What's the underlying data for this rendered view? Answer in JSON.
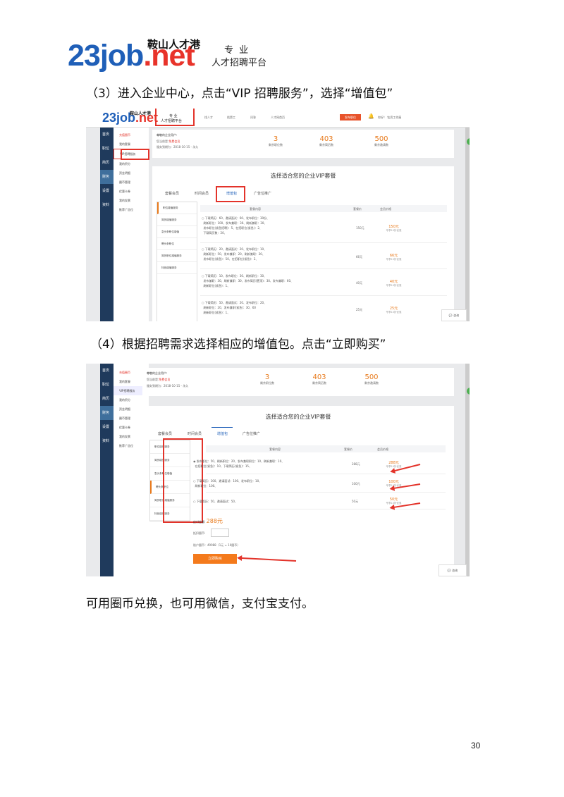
{
  "logo": {
    "main": "23job",
    "net": ".net",
    "cn_name": "鞍山人才港",
    "tag1": "专 业",
    "tag2": "人才招聘平台"
  },
  "steps": {
    "s3": "（3）进入企业中心，点击“VIP 招聘服务”，选择“增值包”",
    "s4": "（4）根据招聘需求选择相应的增值包。点击“立即购买”",
    "note": "可用圈币兑换，也可用微信，支付宝支付。"
  },
  "shot1": {
    "logo_cn": "鞍山人才港",
    "logo_tag1": "专 业",
    "logo_tag2": "人才招聘平台",
    "topnav": [
      "找人才",
      "找第工",
      "问答",
      "人才网首页"
    ],
    "publish": "发布职位",
    "user": "你好！ 钛资工作屋",
    "side": [
      "首页",
      "职位",
      "简历",
      "财务",
      "设置",
      "资料"
    ],
    "menu": [
      "充值圈币",
      "我的套餐",
      "VIP招聘服务",
      "我的积分",
      "资金明细",
      "圈币管理",
      "优惠卡券",
      "我的发票",
      "推荐广告位"
    ],
    "greet": "尊敬的企业用户:",
    "level_label": "您当前是:",
    "level": "免费会员",
    "expire": "服务到期为：2018-10-15 - 永久",
    "stats": [
      {
        "num": "3",
        "label": "剩余职位数"
      },
      {
        "num": "403",
        "label": "剩余简历数"
      },
      {
        "num": "500",
        "label": "剩余邀请数"
      }
    ],
    "panel_title": "选择适合您的企业VIP套餐",
    "tabs": [
      "套餐会员",
      "时间会员",
      "增值包",
      "广告位推广"
    ],
    "pkg_list": [
      "职位增值服务",
      "简历增值服务",
      "急头条职位增值",
      "聘头条职位",
      "简历职位增值服务",
      "特色增值服务"
    ],
    "headers": {
      "content": "套餐内容",
      "qty": "套餐价",
      "price": "会员价格"
    },
    "rows": [
      {
        "l1": "下载简历：60、邀请面试：60、发布职位：30份、",
        "l2": "刷新职位：100、发布兼职：30、刷新兼职：30、",
        "l3": "发布职位(紧急招聘)：5、在招职位(紧急)：2、",
        "l4": "下载简历数：20、",
        "qty": "150元",
        "price": "150元",
        "sub": "专享10折优惠"
      },
      {
        "l1": "下载简历：20、邀请面试：20、发布职位：10、",
        "l2": "刷新职位：50、发布兼职：20、刷新兼职：20、",
        "l3": "发布职位(紧急)：50、在招职位(紧急)：2、",
        "l4": "",
        "qty": "66元",
        "price": "66元",
        "sub": "专享10折优惠"
      },
      {
        "l1": "下载简历：10、发布职位：30、刷新职位：30、",
        "l2": "发布兼职：30、刷新兼职：30、发布简历(置顶)：30、发布兼职：60、",
        "l3": "刷新职位(紧急)：1、",
        "l4": "",
        "qty": "40元",
        "price": "40元",
        "sub": "专享10折优惠"
      },
      {
        "l1": "下载简历：50、邀请面试：20、发布职位：20、",
        "l2": "刷新职位：20、发布兼职(紧急)：30、60",
        "l3": "刷新职位(紧急)：1、",
        "l4": "",
        "qty": "25元",
        "price": "25元",
        "sub": "专享10折优惠"
      }
    ],
    "consult": "咨询"
  },
  "shot2": {
    "side": [
      "首页",
      "职位",
      "简历",
      "财务",
      "设置",
      "资料"
    ],
    "menu": [
      "充值圈币",
      "我的套餐",
      "VIP招聘服务",
      "我的积分",
      "资金明细",
      "圈币管理",
      "优惠卡券",
      "我的发票",
      "推荐广告位"
    ],
    "greet": "尊敬的企业用户:",
    "level_label": "您当前是:",
    "level": "免费会员",
    "expire": "服务到期为：2018-10-15 - 永久",
    "stats": [
      {
        "num": "3",
        "label": "剩余职位数"
      },
      {
        "num": "403",
        "label": "剩余简历数"
      },
      {
        "num": "500",
        "label": "剩余邀请数"
      }
    ],
    "panel_title": "选择适合您的企业VIP套餐",
    "tabs": [
      "套餐会员",
      "时间会员",
      "增值包",
      "广告位推广"
    ],
    "pkg_list": [
      "职位增值服务",
      "简历增值服务",
      "急头条职位增值",
      "聘头条职位",
      "简历职位增值服务",
      "特色增值服务"
    ],
    "headers": {
      "content": "套餐内容",
      "qty": "套餐价",
      "price": "会员价格"
    },
    "rows": [
      {
        "l1": "发布职位：50、刷新职位：20、发布兼职职位：10、刷新兼职：10、",
        "l2": "在招职位(紧急)：10、下载简历(紧急)：15、",
        "qty": "288元",
        "price": "288元",
        "sub": "专享10折优惠",
        "checked": true
      },
      {
        "l1": "下载简历：100、邀请面试：100、发布职位：10、",
        "l2": "刷新职位：100、",
        "qty": "100元",
        "price": "100元",
        "sub": "专享10折优惠",
        "checked": false
      },
      {
        "l1": "下载简历：50、邀请面试：50、",
        "l2": "",
        "qty": "50元",
        "price": "50元",
        "sub": "专享10折优惠",
        "checked": false
      }
    ],
    "pay_label": "应付金额:",
    "pay_amount": "288元",
    "coin_label": "抵扣圈币:",
    "account": "账户圈币：49988（1元 = 10圈币）",
    "buy": "立即购买",
    "consult": "咨询"
  },
  "page_number": "30"
}
